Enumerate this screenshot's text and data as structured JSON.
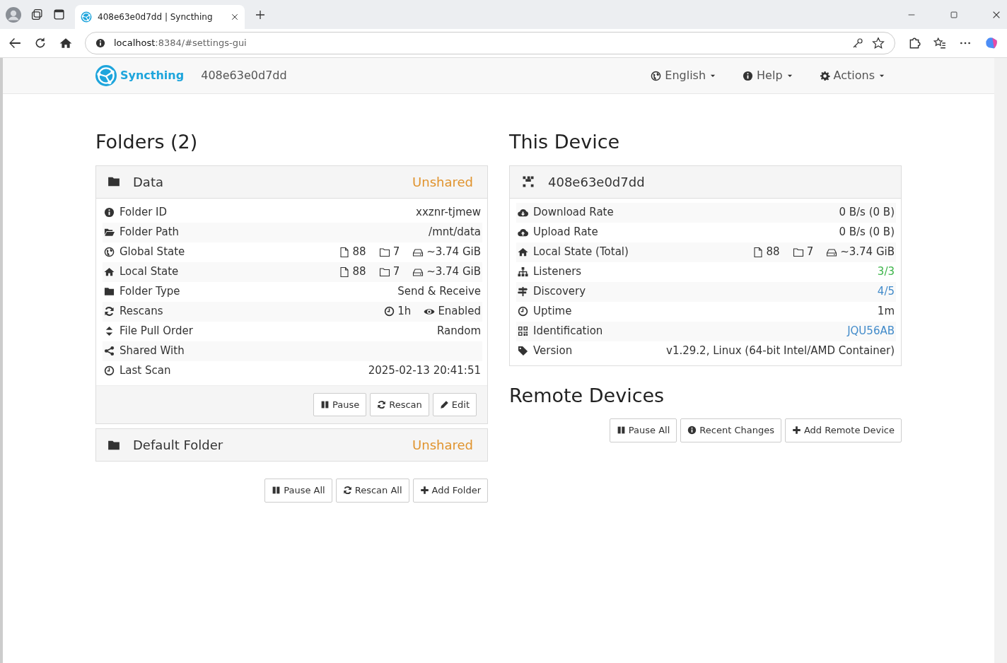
{
  "browser": {
    "tab_title": "408e63e0d7dd | Syncthing",
    "url_host": "localhost",
    "url_path": ":8384/#settings-gui"
  },
  "navbar": {
    "brand": "Syncthing",
    "device_name": "408e63e0d7dd",
    "menus": [
      "English",
      "Help",
      "Actions"
    ]
  },
  "folders": {
    "title": "Folders (2)",
    "items": [
      {
        "name": "Data",
        "status": "Unshared",
        "expanded": true,
        "rows": [
          {
            "kind": "text",
            "label": "Folder ID",
            "value": "xxznr-tjmew"
          },
          {
            "kind": "text",
            "label": "Folder Path",
            "value": "/mnt/data"
          },
          {
            "kind": "stats",
            "label": "Global State",
            "files": "88",
            "dirs": "7",
            "size": "~3.74 GiB"
          },
          {
            "kind": "stats",
            "label": "Local State",
            "files": "88",
            "dirs": "7",
            "size": "~3.74 GiB"
          },
          {
            "kind": "text",
            "label": "Folder Type",
            "value": "Send & Receive"
          },
          {
            "kind": "rescan",
            "label": "Rescans",
            "interval": "1h",
            "watcher": "Enabled"
          },
          {
            "kind": "text",
            "label": "File Pull Order",
            "value": "Random"
          },
          {
            "kind": "text",
            "label": "Shared With"
          },
          {
            "kind": "text",
            "label": "Last Scan",
            "value": "2025-02-13 20:41:51"
          }
        ],
        "buttons": [
          "Pause",
          "Rescan",
          "Edit"
        ]
      },
      {
        "name": "Default Folder",
        "status": "Unshared",
        "expanded": false
      }
    ],
    "buttons": [
      "Pause All",
      "Rescan All",
      "Add Folder"
    ]
  },
  "this_device": {
    "title": "This Device",
    "name": "408e63e0d7dd",
    "rows": [
      {
        "kind": "text",
        "label": "Download Rate",
        "value": "0 B/s (0 B)"
      },
      {
        "kind": "text",
        "label": "Upload Rate",
        "value": "0 B/s (0 B)"
      },
      {
        "kind": "stats",
        "label": "Local State (Total)",
        "files": "88",
        "dirs": "7",
        "size": "~3.74 GiB"
      },
      {
        "kind": "text",
        "label": "Listeners",
        "value": "3/3",
        "color": "#3cb449"
      },
      {
        "kind": "text",
        "label": "Discovery",
        "value": "4/5",
        "color": "#428bca"
      },
      {
        "kind": "text",
        "label": "Uptime",
        "value": "1m"
      },
      {
        "kind": "link",
        "label": "Identification",
        "value": "JQU56AB",
        "color": "#428bca"
      },
      {
        "kind": "text",
        "label": "Version",
        "value": "v1.29.2, Linux (64-bit Intel/AMD Container)"
      }
    ]
  },
  "remote_devices": {
    "title": "Remote Devices",
    "buttons": [
      "Pause All",
      "Recent Changes",
      "Add Remote Device"
    ]
  }
}
